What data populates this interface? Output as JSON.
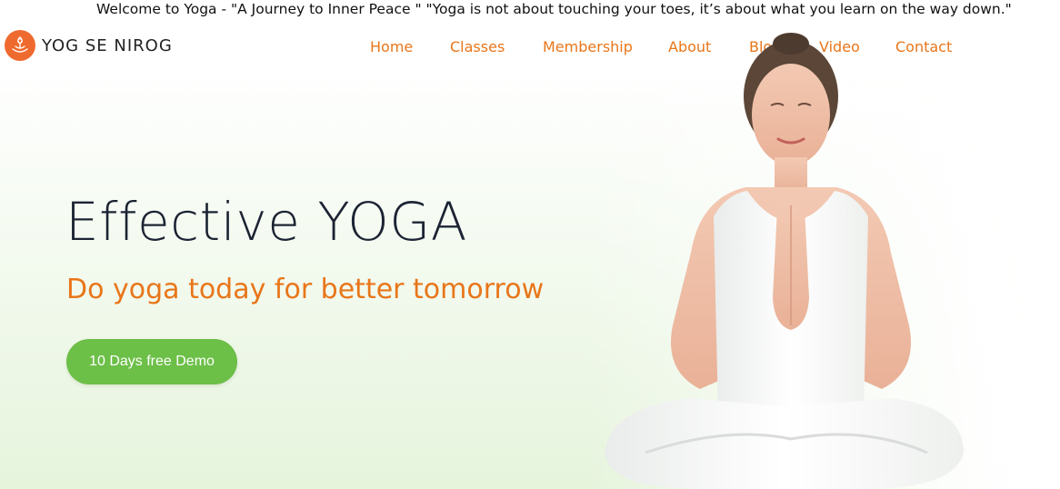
{
  "marquee": {
    "text": "Welcome to Yoga - \"A Journey to Inner Peace \" \"Yoga is not about touching your toes, it’s about what you learn on the way down.\""
  },
  "brand": {
    "name": "YOG SE NIROG",
    "logo_icon": "lotus-meditation-icon",
    "accent_color": "#ef6a2e"
  },
  "nav": {
    "items": [
      {
        "label": "Home"
      },
      {
        "label": "Classes"
      },
      {
        "label": "Membership"
      },
      {
        "label": "About"
      },
      {
        "label": "Blog"
      },
      {
        "label": "Video"
      },
      {
        "label": "Contact"
      }
    ],
    "color": "#e8761a"
  },
  "hero": {
    "title": "Effective YOGA",
    "subtitle": "Do yoga today for better tomorrow",
    "cta_label": "10 Days free Demo",
    "cta_color": "#6cbf47"
  }
}
